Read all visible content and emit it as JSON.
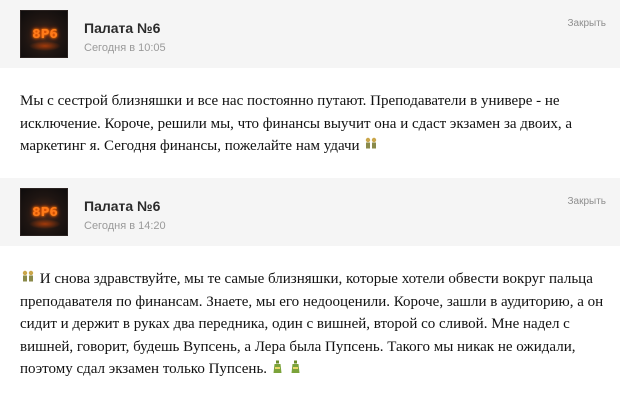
{
  "posts": [
    {
      "author": "Палата №6",
      "time": "Сегодня в 10:05",
      "close": "Закрыть",
      "text": "Мы с сестрой близняшки и все нас постоянно путают. Преподаватели в универе - не исключение. Короче, решили мы, что финансы выучит она и сдаст экзамен за двоих, а маркетинг я. Сегодня финансы, пожелайте нам удачи",
      "trailing_icon": "twins-emoji-icon"
    },
    {
      "author": "Палата №6",
      "time": "Сегодня в 14:20",
      "close": "Закрыть",
      "leading_icon": "twins-emoji-icon",
      "text": "И снова здравствуйте, мы те самые близняшки, которые хотели обвести вокруг пальца преподавателя по финансам. Знаете, мы его недооценили. Короче, зашли в аудиторию, а он сидит и держит в руках два передника, один с вишней, второй со сливой. Мне надел с вишней, говорит, будешь Вупсень, а Лера была Пупсень. Такого мы никак не ожидали, поэтому сдал экзамен только Пупсень.",
      "trailing_icons": [
        "bottle-emoji-icon",
        "bottle-emoji-icon"
      ]
    }
  ],
  "avatar_logo": "8Р6",
  "colors": {
    "logo": "#ff7a1a",
    "header_bg": "#f5f5f5"
  }
}
